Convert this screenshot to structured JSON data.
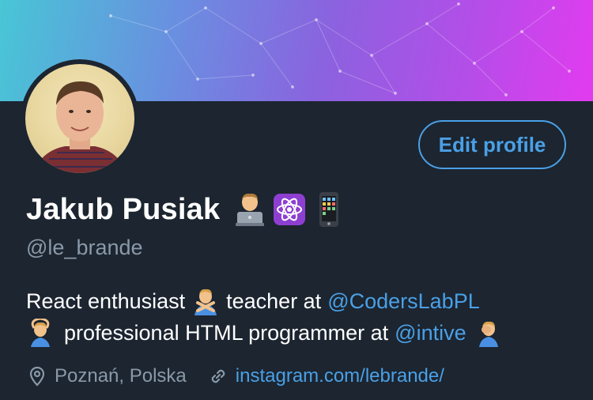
{
  "profile": {
    "name": "Jakub Pusiak",
    "handle": "@le_brande",
    "edit_label": "Edit profile",
    "name_emoji_icons": [
      "technologist-icon",
      "atom-icon",
      "mobile-phone-icon"
    ]
  },
  "bio": {
    "line1_text1": "React enthusiast",
    "line1_text2": "teacher at",
    "line1_link": "@CodersLabPL",
    "line2_text1": "professional HTML programmer at",
    "line2_link": "@intive"
  },
  "meta": {
    "location": "Poznań, Polska",
    "website": "instagram.com/lebrande/"
  },
  "colors": {
    "background": "#1c2530",
    "accent": "#4aa0e6",
    "muted": "#8a99a8",
    "banner_start": "#48c6d6",
    "banner_end": "#e23bef"
  }
}
